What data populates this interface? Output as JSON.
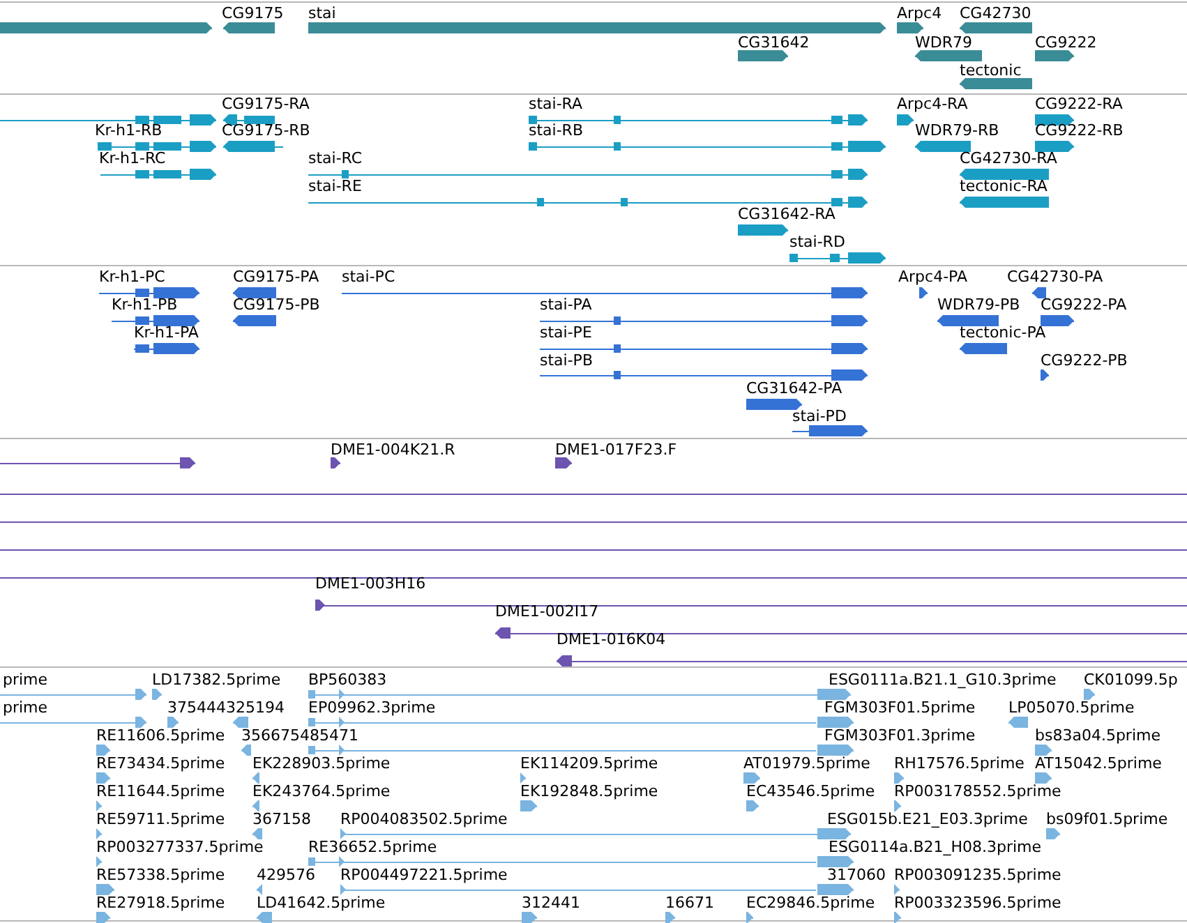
{
  "tracks": [
    {
      "color": "#3a8c96",
      "features": [
        {
          "kind": "feature",
          "reverse": false
        },
        {
          "kind": "feature",
          "label": "CG9175",
          "reverse": true
        },
        {
          "kind": "feature",
          "label": "stai",
          "reverse": false
        },
        {
          "kind": "feature",
          "label": "Arpc4",
          "reverse": false
        },
        {
          "kind": "feature",
          "label": "CG42730",
          "reverse": true
        },
        {
          "kind": "feature",
          "label": "CG31642",
          "reverse": false
        },
        {
          "kind": "feature",
          "label": "WDR79",
          "reverse": true
        },
        {
          "kind": "feature",
          "label": "CG9222",
          "reverse": false
        },
        {
          "kind": "feature",
          "label": "tectonic",
          "reverse": true
        }
      ]
    },
    {
      "color": "#1b9ec4",
      "features": [
        {
          "kind": "feature",
          "reverse": false
        },
        {
          "kind": "feature",
          "label": "CG9175-RA",
          "reverse": true
        },
        {
          "kind": "feature",
          "label": "stai-RA",
          "reverse": false
        },
        {
          "kind": "feature",
          "label": "Arpc4-RA",
          "reverse": false
        },
        {
          "kind": "feature",
          "label": "CG9222-RA",
          "reverse": false
        },
        {
          "kind": "feature",
          "label": "Kr-h1-RB",
          "reverse": false
        },
        {
          "kind": "feature",
          "label": "CG9175-RB",
          "reverse": true
        },
        {
          "kind": "feature",
          "label": "stai-RB",
          "reverse": false
        },
        {
          "kind": "feature",
          "label": "WDR79-RB",
          "reverse": true
        },
        {
          "kind": "feature",
          "label": "CG9222-RB",
          "reverse": false
        },
        {
          "kind": "feature",
          "label": "Kr-h1-RC",
          "reverse": false
        },
        {
          "kind": "feature",
          "label": "stai-RC",
          "reverse": false
        },
        {
          "kind": "feature",
          "label": "CG42730-RA",
          "reverse": true
        },
        {
          "kind": "feature",
          "label": "stai-RE",
          "reverse": false
        },
        {
          "kind": "feature",
          "label": "tectonic-RA",
          "reverse": true
        },
        {
          "kind": "feature",
          "label": "CG31642-RA",
          "reverse": false
        },
        {
          "kind": "feature",
          "label": "stai-RD",
          "reverse": false
        }
      ]
    },
    {
      "color": "#3572d6",
      "features": [
        {
          "kind": "feature",
          "label": "Kr-h1-PC",
          "reverse": false
        },
        {
          "kind": "feature",
          "label": "CG9175-PA",
          "reverse": true
        },
        {
          "kind": "feature",
          "label": "stai-PC",
          "reverse": false
        },
        {
          "kind": "feature",
          "label": "Arpc4-PA",
          "reverse": false
        },
        {
          "kind": "feature",
          "label": "CG42730-PA",
          "reverse": true
        },
        {
          "kind": "feature",
          "label": "Kr-h1-PB",
          "reverse": false
        },
        {
          "kind": "feature",
          "label": "CG9175-PB",
          "reverse": true
        },
        {
          "kind": "feature",
          "label": "stai-PA",
          "reverse": false
        },
        {
          "kind": "feature",
          "label": "WDR79-PB",
          "reverse": true
        },
        {
          "kind": "feature",
          "label": "CG9222-PA",
          "reverse": false
        },
        {
          "kind": "feature",
          "label": "Kr-h1-PA",
          "reverse": false
        },
        {
          "kind": "feature",
          "label": "stai-PE",
          "reverse": false
        },
        {
          "kind": "feature",
          "label": "tectonic-PA",
          "reverse": true
        },
        {
          "kind": "feature",
          "label": "stai-PB",
          "reverse": false
        },
        {
          "kind": "feature",
          "label": "CG9222-PB",
          "reverse": false
        },
        {
          "kind": "feature",
          "label": "CG31642-PA",
          "reverse": false
        },
        {
          "kind": "feature",
          "label": "stai-PD",
          "reverse": false
        }
      ]
    },
    {
      "color": "#6c54b0",
      "features": [
        {
          "kind": "feature",
          "reverse": false
        },
        {
          "kind": "feature",
          "label": "DME1-004K21.R",
          "reverse": false
        },
        {
          "kind": "feature",
          "label": "DME1-017F23.F",
          "reverse": false
        },
        {
          "kind": "span"
        },
        {
          "kind": "span"
        },
        {
          "kind": "span"
        },
        {
          "kind": "span"
        },
        {
          "kind": "feature",
          "label": "DME1-003H16",
          "reverse": false
        },
        {
          "kind": "feature",
          "label": "DME1-002I17",
          "reverse": true
        },
        {
          "kind": "feature",
          "label": "DME1-016K04",
          "reverse": true
        }
      ]
    },
    {
      "color": "#7ab4e0",
      "features": [
        {
          "kind": "feature",
          "label": "prime",
          "reverse": false
        },
        {
          "kind": "feature",
          "label": "LD17382.5prime",
          "reverse": false
        },
        {
          "kind": "feature",
          "label": "BP560383",
          "reverse": false
        },
        {
          "kind": "feature",
          "label": "ESG0111a.B21.1_G10.3prime",
          "reverse": false
        },
        {
          "kind": "feature",
          "label": "CK01099.5p",
          "reverse": false
        },
        {
          "kind": "feature",
          "label": "prime",
          "reverse": false
        },
        {
          "kind": "feature",
          "label": "375444325194",
          "reverse": false
        },
        {
          "kind": "feature",
          "reverse": true
        },
        {
          "kind": "feature",
          "label": "EP09962.3prime",
          "reverse": false
        },
        {
          "kind": "feature",
          "label": "FGM303F01.5prime",
          "reverse": false
        },
        {
          "kind": "feature",
          "label": "LP05070.5prime",
          "reverse": true
        },
        {
          "kind": "feature",
          "label": "RE11606.5prime",
          "reverse": false
        },
        {
          "kind": "feature",
          "label": "356675485471",
          "reverse": true
        },
        {
          "kind": "feature",
          "reverse": false
        },
        {
          "kind": "feature",
          "label": "FGM303F01.3prime",
          "reverse": false
        },
        {
          "kind": "feature",
          "label": "bs83a04.5prime",
          "reverse": false
        },
        {
          "kind": "feature",
          "label": "RE73434.5prime",
          "reverse": false
        },
        {
          "kind": "feature",
          "label": "EK228903.5prime",
          "reverse": true
        },
        {
          "kind": "feature",
          "label": "EK114209.5prime",
          "reverse": false
        },
        {
          "kind": "feature",
          "label": "AT01979.5prime",
          "reverse": false
        },
        {
          "kind": "feature",
          "label": "RH17576.5prime",
          "reverse": false
        },
        {
          "kind": "feature",
          "label": "AT15042.5prime",
          "reverse": false
        },
        {
          "kind": "feature",
          "label": "RE11644.5prime",
          "reverse": false
        },
        {
          "kind": "feature",
          "label": "EK243764.5prime",
          "reverse": true
        },
        {
          "kind": "feature",
          "label": "EK192848.5prime",
          "reverse": false
        },
        {
          "kind": "feature",
          "label": "EC43546.5prime",
          "reverse": false
        },
        {
          "kind": "feature",
          "label": "RP003178552.5prime",
          "reverse": false
        },
        {
          "kind": "feature",
          "label": "RE59711.5prime",
          "reverse": false
        },
        {
          "kind": "feature",
          "label": "367158",
          "reverse": true
        },
        {
          "kind": "feature",
          "label": "RP004083502.5prime",
          "reverse": false
        },
        {
          "kind": "feature",
          "label": "ESG015b.E21_E03.3prime",
          "reverse": false
        },
        {
          "kind": "feature",
          "label": "bs09f01.5prime",
          "reverse": false
        },
        {
          "kind": "feature",
          "label": "RP003277337.5prime",
          "reverse": false
        },
        {
          "kind": "feature",
          "label": "RE36652.5prime",
          "reverse": false
        },
        {
          "kind": "feature",
          "label": "ESG0114a.B21_H08.3prime",
          "reverse": false
        },
        {
          "kind": "feature",
          "label": "RE57338.5prime",
          "reverse": false
        },
        {
          "kind": "feature",
          "label": "429576",
          "reverse": true
        },
        {
          "kind": "feature",
          "label": "RP004497221.5prime",
          "reverse": false
        },
        {
          "kind": "feature",
          "label": "317060",
          "reverse": false
        },
        {
          "kind": "feature",
          "label": "RP003091235.5prime",
          "reverse": false
        },
        {
          "kind": "feature",
          "label": "RE27918.5prime",
          "reverse": false
        },
        {
          "kind": "feature",
          "label": "LD41642.5prime",
          "reverse": true
        },
        {
          "kind": "feature",
          "label": "312441",
          "reverse": false
        },
        {
          "kind": "feature",
          "label": "16671",
          "reverse": false
        },
        {
          "kind": "feature",
          "label": "EC29846.5prime",
          "reverse": false
        },
        {
          "kind": "feature",
          "label": "RP003323596.5prime",
          "reverse": false
        }
      ]
    }
  ]
}
